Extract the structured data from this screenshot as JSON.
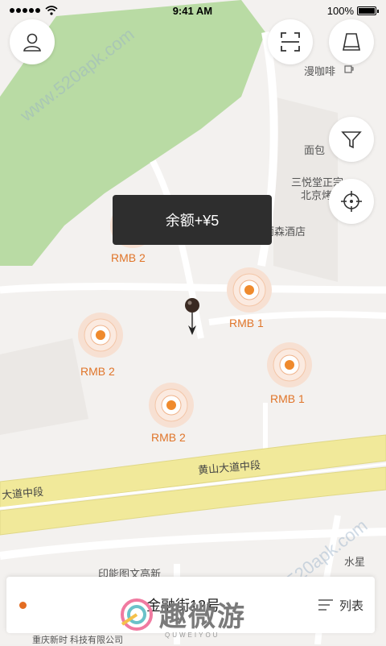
{
  "status_bar": {
    "time": "9:41 AM",
    "battery": "100%"
  },
  "toast": {
    "text": "余额+¥5"
  },
  "beacons": [
    {
      "label": "RMB 2"
    },
    {
      "label": "RMB 1"
    },
    {
      "label": "RMB 2"
    },
    {
      "label": "RMB 1"
    },
    {
      "label": "RMB 2"
    }
  ],
  "map_labels": {
    "cafe": "漫咖啡",
    "bakery": "面包",
    "poi_1": "三悦堂正宗",
    "poi_2": "北京烤",
    "hotel": "重庆丽森酒店",
    "printer": "印能图文高新",
    "water": "水星",
    "bottom_poi": "重庆新时 科技有限公司"
  },
  "roads": {
    "main_right": "黄山大道中段",
    "main_left": "大道中段"
  },
  "bottom_bar": {
    "address": "金融街12号",
    "list_label": "列表"
  },
  "watermarks": {
    "top": "www.520apk.com",
    "bottom": "www.520apk.com"
  },
  "logo": {
    "text": "趣微游",
    "subtitle": "QUWEIYOU"
  },
  "icons": {
    "profile": "person-icon",
    "scan": "scan-icon",
    "cup": "cup-icon",
    "filter": "filter-icon",
    "locate": "crosshair-icon",
    "menu": "list-icon",
    "pin": "location-pin-icon"
  },
  "colors": {
    "accent": "#e36d22",
    "park": "#b7dca0",
    "road": "#f2ea9a"
  }
}
